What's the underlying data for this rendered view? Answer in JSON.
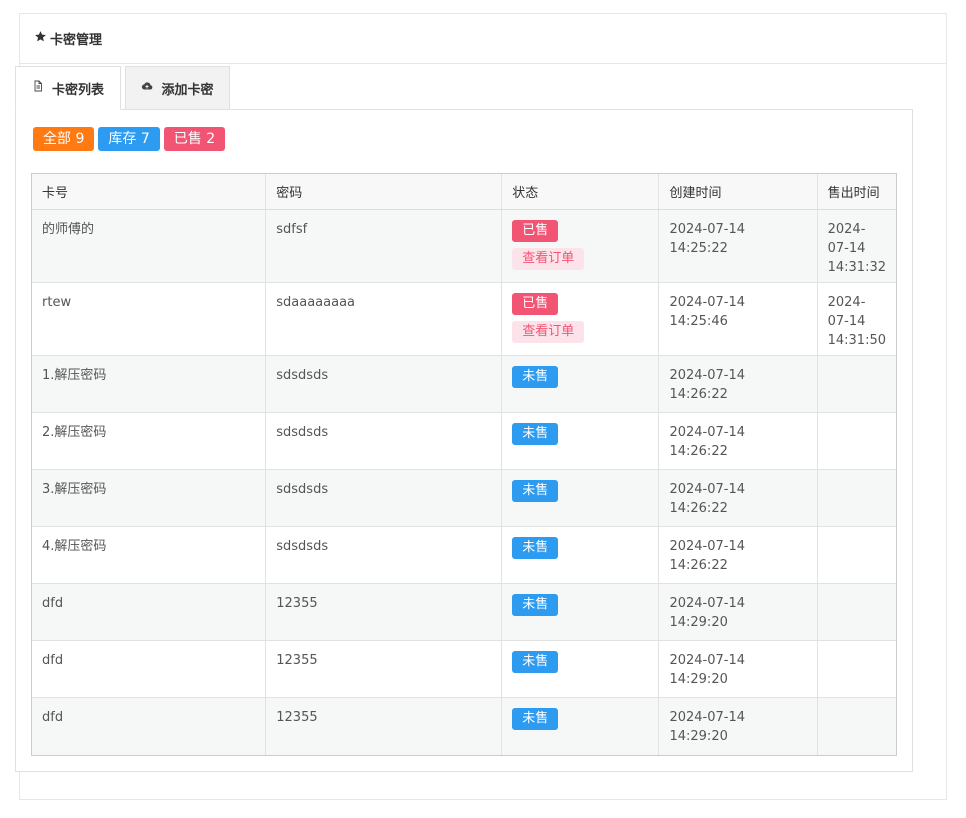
{
  "panel": {
    "title": "卡密管理"
  },
  "tabs": [
    {
      "label": "卡密列表",
      "active": true
    },
    {
      "label": "添加卡密",
      "active": false
    }
  ],
  "filters": {
    "all": {
      "label": "全部",
      "count": "9"
    },
    "stock": {
      "label": "库存",
      "count": "7"
    },
    "sold": {
      "label": "已售",
      "count": "2"
    }
  },
  "table": {
    "headers": [
      "卡号",
      "密码",
      "状态",
      "创建时间",
      "售出时间"
    ],
    "view_order_label": "查看订单",
    "rows": [
      {
        "card": "的师傅的",
        "password": "sdfsf",
        "status": "已售",
        "created_date": "2024-07-14",
        "created_time": "14:25:22",
        "sold_date": "2024-07-14",
        "sold_time": "14:31:32"
      },
      {
        "card": "rtew",
        "password": "sdaaaaaaaa",
        "status": "已售",
        "created_date": "2024-07-14",
        "created_time": "14:25:46",
        "sold_date": "2024-07-14",
        "sold_time": "14:31:50"
      },
      {
        "card": "1.解压密码",
        "password": "sdsdsds",
        "status": "未售",
        "created_date": "2024-07-14",
        "created_time": "14:26:22",
        "sold_date": "",
        "sold_time": ""
      },
      {
        "card": "2.解压密码",
        "password": "sdsdsds",
        "status": "未售",
        "created_date": "2024-07-14",
        "created_time": "14:26:22",
        "sold_date": "",
        "sold_time": ""
      },
      {
        "card": "3.解压密码",
        "password": "sdsdsds",
        "status": "未售",
        "created_date": "2024-07-14",
        "created_time": "14:26:22",
        "sold_date": "",
        "sold_time": ""
      },
      {
        "card": "4.解压密码",
        "password": "sdsdsds",
        "status": "未售",
        "created_date": "2024-07-14",
        "created_time": "14:26:22",
        "sold_date": "",
        "sold_time": ""
      },
      {
        "card": "dfd",
        "password": "12355",
        "status": "未售",
        "created_date": "2024-07-14",
        "created_time": "14:29:20",
        "sold_date": "",
        "sold_time": ""
      },
      {
        "card": "dfd",
        "password": "12355",
        "status": "未售",
        "created_date": "2024-07-14",
        "created_time": "14:29:20",
        "sold_date": "",
        "sold_time": ""
      },
      {
        "card": "dfd",
        "password": "12355",
        "status": "未售",
        "created_date": "2024-07-14",
        "created_time": "14:29:20",
        "sold_date": "",
        "sold_time": ""
      }
    ]
  },
  "colors": {
    "orange": "#ff7a12",
    "blue": "#2d9bf0",
    "pink": "#f25474"
  },
  "icons": {
    "panel": "star-icon",
    "tab_list": "document-icon",
    "tab_add": "cloud-upload-icon"
  }
}
